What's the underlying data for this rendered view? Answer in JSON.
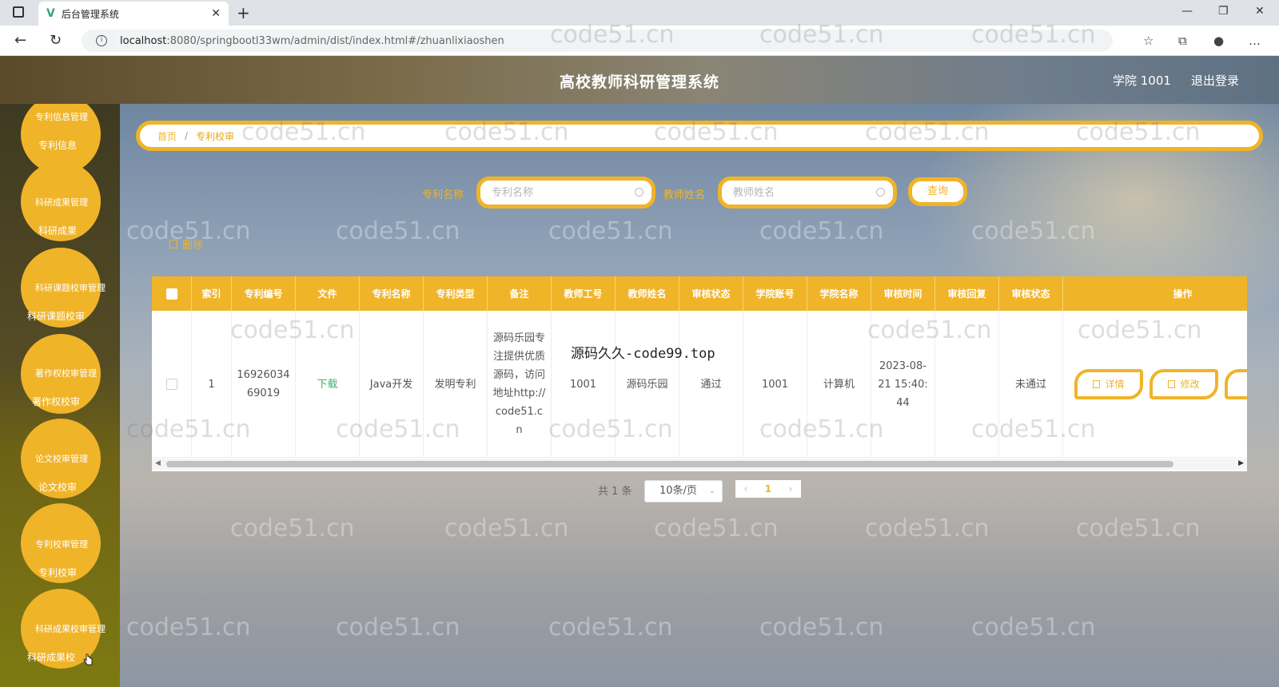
{
  "browser": {
    "tab_title": "后台管理系统",
    "tab_logo": "V",
    "url_host": "localhost",
    "url_path": ":8080/springbootl33wm/admin/dist/index.html#/zhuanlixiaoshen",
    "icons": [
      "sidebar-icon",
      "close-icon",
      "new-tab-icon",
      "back-icon",
      "reload-icon",
      "info-icon",
      "key-icon",
      "read-aloud-icon",
      "favorite-add-icon",
      "favorites-icon",
      "collections-icon",
      "profile-icon",
      "more-icon"
    ]
  },
  "header": {
    "title": "高校教师科研管理系统",
    "user": "学院 1001",
    "logout": "退出登录"
  },
  "sidebar": {
    "groups": [
      {
        "title": "专利信息管理",
        "item": "专利信息"
      },
      {
        "title": "科研成果管理",
        "item": "科研成果"
      },
      {
        "title": "科研课题校审管理",
        "item": "科研课题校审"
      },
      {
        "title": "著作权校审管理",
        "item": "著作权校审"
      },
      {
        "title": "论文校审管理",
        "item": "论文校审"
      },
      {
        "title": "专利校审管理",
        "item": "专利校审"
      },
      {
        "title": "科研成果校审管理",
        "item": "科研成果校"
      }
    ]
  },
  "breadcrumb": {
    "home": "首页",
    "sep": "/",
    "current": "专利校审"
  },
  "search": {
    "field1_label": "专利名称",
    "field1_placeholder": "专利名称",
    "field2_label": "教师姓名",
    "field2_placeholder": "教师姓名",
    "button": "查询"
  },
  "toolbar": {
    "delete": "删除"
  },
  "table": {
    "headers": [
      "索引",
      "专利编号",
      "文件",
      "专利名称",
      "专利类型",
      "备注",
      "教师工号",
      "教师姓名",
      "审核状态",
      "学院账号",
      "学院名称",
      "审核时间",
      "审核回复",
      "审核状态",
      "操作"
    ],
    "row": {
      "index": "1",
      "patent_no": "1692603469019",
      "file": "下载",
      "patent_name": "Java开发",
      "patent_type": "发明专利",
      "remark": "源码乐园专注提供优质源码，访问地址http://code51.cn",
      "teacher_no": "1001",
      "teacher_name": "源码乐园",
      "review_status": "通过",
      "college_account": "1001",
      "college_name": "计算机",
      "review_time": "2023-08-21 15:40:44",
      "review_reply": "",
      "review_status2": "未通过",
      "op_detail": "详情",
      "op_edit": "修改"
    }
  },
  "overlay_text": "源码久久-code99.top",
  "pagination": {
    "total": "共 1 条",
    "page_size": "10条/页",
    "current_page": "1"
  },
  "watermark": "code51.cn"
}
